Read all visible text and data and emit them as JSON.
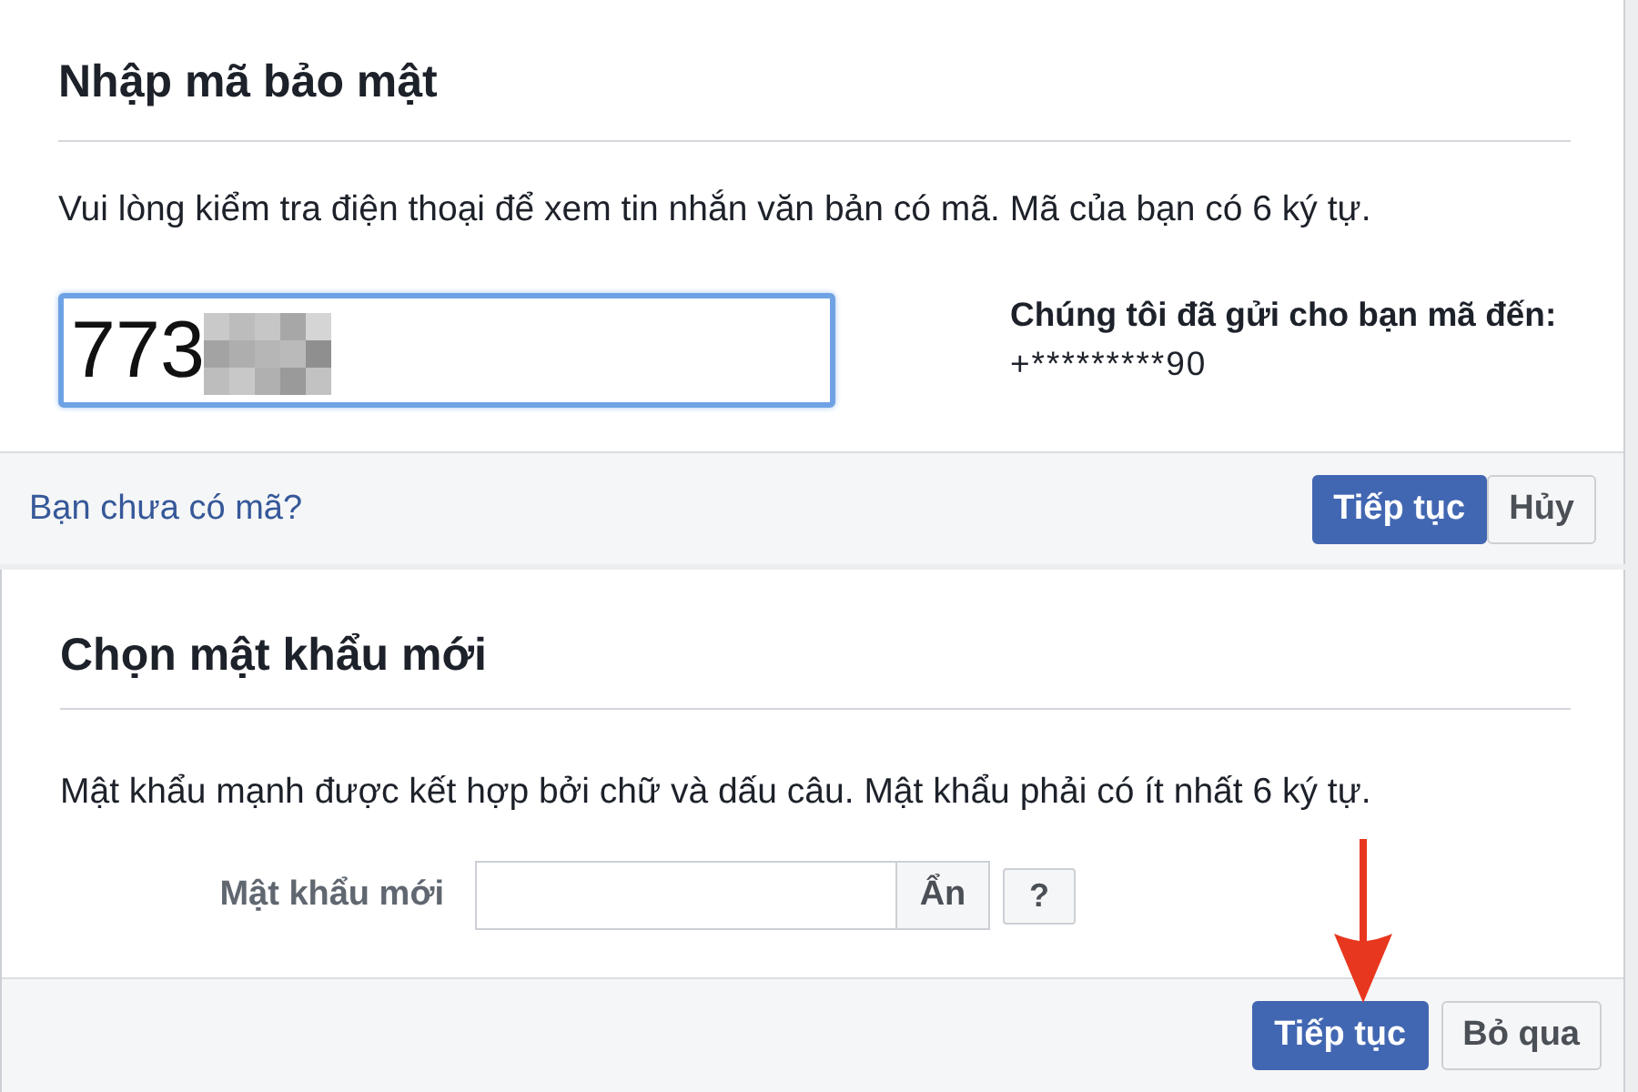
{
  "code_panel": {
    "title": "Nhập mã bảo mật",
    "instructions": "Vui lòng kiểm tra điện thoại để xem tin nhắn văn bản có mã. Mã của bạn có 6 ký tự.",
    "code_field": {
      "value": "773",
      "focused": true,
      "redacted": true
    },
    "sent_to": {
      "label": "Chúng tôi đã gửi cho bạn mã đến:",
      "phone": "+*********90"
    },
    "footer": {
      "link": "Bạn chưa có mã?",
      "buttons": [
        {
          "label": "Tiếp tục",
          "kind": "primary",
          "pointed_at": false
        },
        {
          "label": "Hủy",
          "kind": "secondary",
          "pointed_at": false
        }
      ]
    }
  },
  "password_panel": {
    "title": "Chọn mật khẩu mới",
    "instructions": "Mật khẩu mạnh được kết hợp bởi chữ và dấu câu. Mật khẩu phải có ít nhất 6 ký tự.",
    "password_field": {
      "label": "Mật khẩu mới",
      "toggle_button": "Ẩn",
      "help_button": "?"
    },
    "footer": {
      "buttons": [
        {
          "label": "Tiếp tục",
          "kind": "primary",
          "pointed_at": true
        },
        {
          "label": "Bỏ qua",
          "kind": "secondary",
          "pointed_at": false
        }
      ]
    }
  }
}
